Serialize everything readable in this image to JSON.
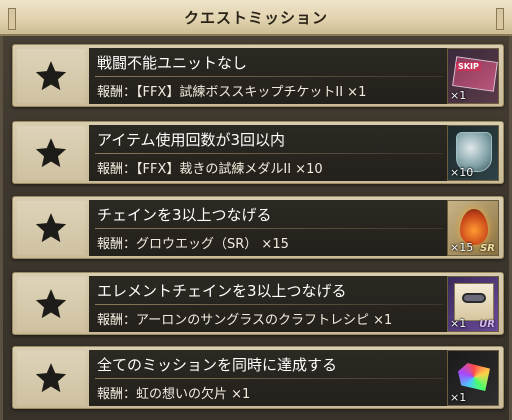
{
  "header": {
    "title": "クエストミッション"
  },
  "missions": [
    {
      "title": "戦闘不能ユニットなし",
      "reward_label": "報酬：",
      "reward": "【FFX】試練ボススキップチケットII ×1",
      "item_count": "×1",
      "item_icon": "skip-ticket",
      "item_colors": [
        "#8a3a5a",
        "#c8335a"
      ],
      "item_badge": "SKIP",
      "rarity": ""
    },
    {
      "title": "アイテム使用回数が3回以内",
      "reward_label": "報酬：",
      "reward": "【FFX】裁きの試練メダルII ×10",
      "item_count": "×10",
      "item_icon": "trial-medal",
      "item_colors": [
        "#7fa0a6",
        "#3c5a60"
      ],
      "rarity": ""
    },
    {
      "title": "チェインを3以上つなげる",
      "reward_label": "報酬：",
      "reward": "グロウエッグ（SR） ×15",
      "item_count": "×15",
      "item_icon": "grow-egg",
      "item_colors": [
        "#ff9a30",
        "#c8461a"
      ],
      "rarity": "SR"
    },
    {
      "title": "エレメントチェインを3以上つなげる",
      "reward_label": "報酬：",
      "reward": "アーロンのサングラスのクラフトレシピ ×1",
      "item_count": "×1",
      "item_icon": "craft-recipe",
      "item_colors": [
        "#f4ecd8",
        "#2a2a2a"
      ],
      "rarity": "UR"
    },
    {
      "title": "全てのミッションを同時に達成する",
      "reward_label": "報酬：",
      "reward": "虹の想いの欠片 ×1",
      "item_count": "×1",
      "item_icon": "rainbow-shard",
      "item_colors": [
        "#a44aff",
        "#4ac8ff"
      ],
      "rarity": ""
    }
  ],
  "star_icon": "star-icon",
  "star_color": "#1e1c18"
}
